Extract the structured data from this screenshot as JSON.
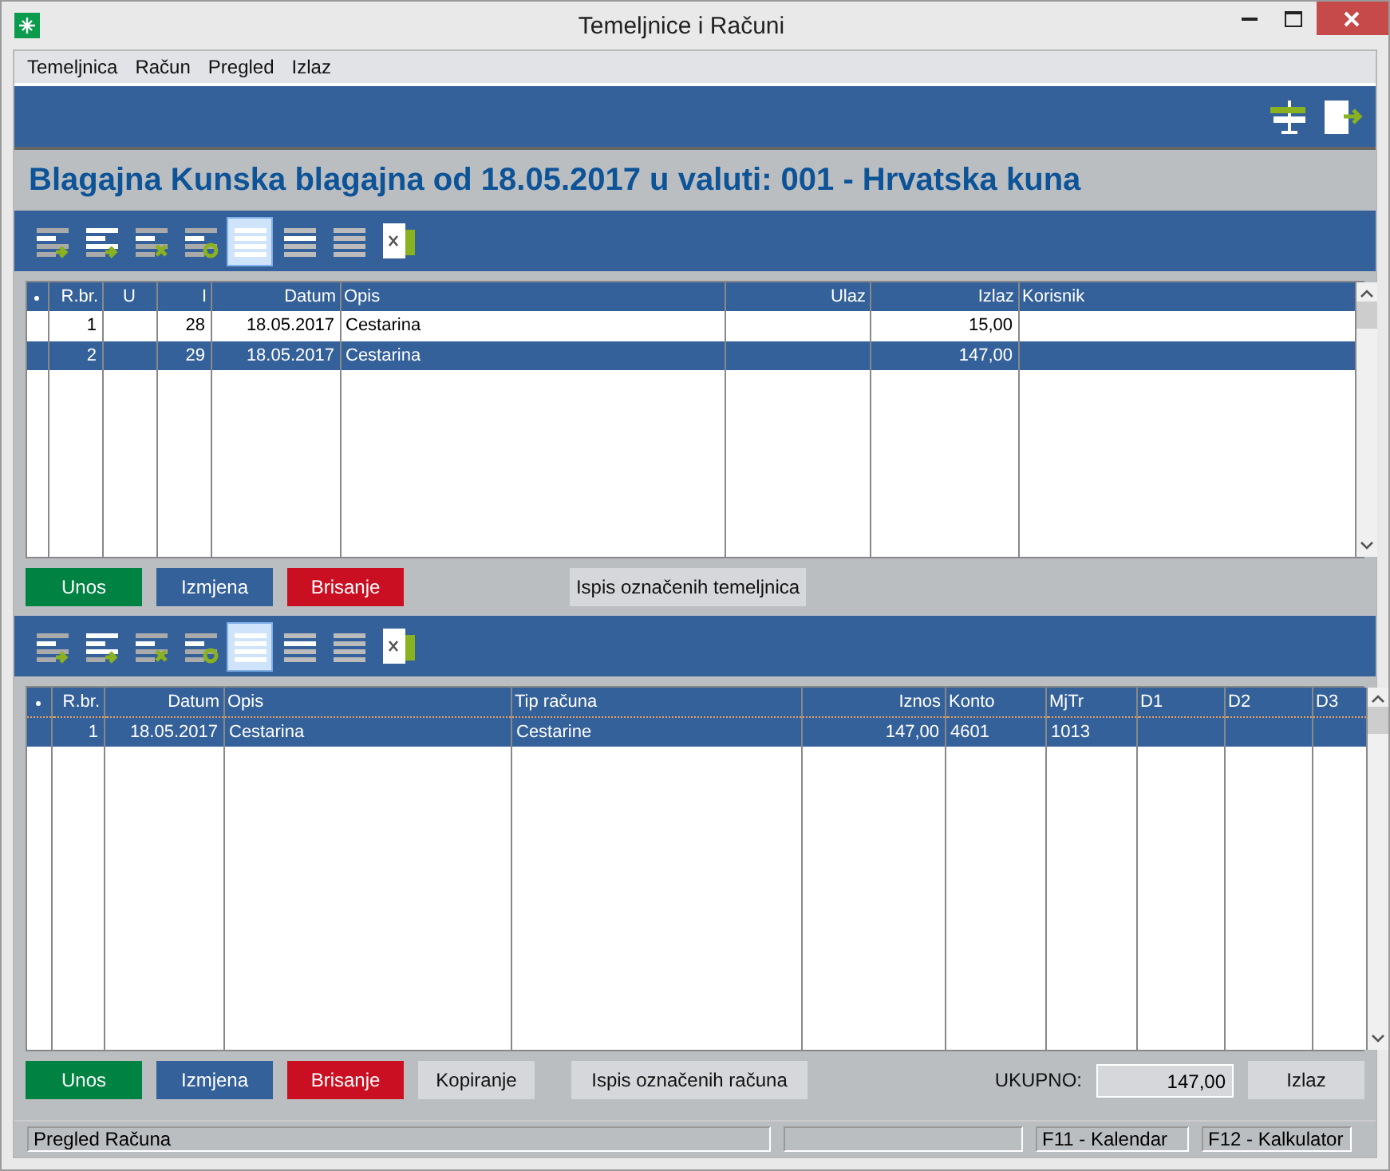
{
  "window": {
    "title": "Temeljnice i Računi"
  },
  "menu": [
    "Temeljnica",
    "Račun",
    "Pregled",
    "Izlaz"
  ],
  "heading": "Blagajna Kunska blagajna od 18.05.2017 u valuti: 001 - Hrvatska kuna",
  "toolbar_top": [
    {
      "kind": "add",
      "selected": false
    },
    {
      "kind": "insert",
      "selected": false
    },
    {
      "kind": "delete",
      "selected": false
    },
    {
      "kind": "refresh",
      "selected": false
    },
    {
      "kind": "lines",
      "selected": true
    },
    {
      "kind": "wide",
      "selected": false
    },
    {
      "kind": "compact",
      "selected": false
    },
    {
      "kind": "excel",
      "selected": false
    }
  ],
  "journal_table": {
    "columns": [
      "R.br.",
      "U",
      "I",
      "Datum",
      "Opis",
      "Ulaz",
      "Izlaz",
      "Korisnik"
    ],
    "rows": [
      {
        "selected": false,
        "cells": [
          "1",
          null,
          "28",
          "18.05.2017",
          "Cestarina",
          null,
          "15,00",
          null
        ]
      },
      {
        "selected": true,
        "cells": [
          "2",
          null,
          "29",
          "18.05.2017",
          "Cestarina",
          null,
          "147,00",
          null
        ]
      }
    ]
  },
  "journal_buttons": [
    {
      "kind": "add",
      "label": "Unos"
    },
    {
      "kind": "edit",
      "label": "Izmjena"
    },
    {
      "kind": "delete",
      "label": "Brisanje"
    },
    {
      "kind": "print",
      "label": "Ispis označenih temeljnica"
    }
  ],
  "toolbar_bottom": [
    {
      "kind": "add",
      "selected": false
    },
    {
      "kind": "insert",
      "selected": false
    },
    {
      "kind": "delete",
      "selected": false
    },
    {
      "kind": "refresh",
      "selected": false
    },
    {
      "kind": "lines",
      "selected": true
    },
    {
      "kind": "wide",
      "selected": false
    },
    {
      "kind": "compact",
      "selected": false
    },
    {
      "kind": "excel",
      "selected": false
    }
  ],
  "invoice_table": {
    "columns": [
      "R.br.",
      "Datum",
      "Opis",
      "Tip računa",
      "Iznos",
      "Konto",
      "MjTr",
      "D1",
      "D2",
      "D3"
    ],
    "rows": [
      {
        "selected": true,
        "cells": [
          "1",
          "18.05.2017",
          "Cestarina",
          "Cestarine",
          "147,00",
          "4601",
          "1013",
          null,
          null,
          null
        ]
      }
    ]
  },
  "invoice_buttons": [
    {
      "kind": "add",
      "label": "Unos"
    },
    {
      "kind": "edit",
      "label": "Izmjena"
    },
    {
      "kind": "delete",
      "label": "Brisanje"
    },
    {
      "kind": "plain",
      "label": "Kopiranje"
    },
    {
      "kind": "print",
      "label": "Ispis označenih računa"
    }
  ],
  "total": {
    "label": "UKUPNO:",
    "value": "147,00"
  },
  "exit_button": "Izlaz",
  "status_bar": {
    "message": "Pregled Računa",
    "shortcuts": [
      "F11 - Kalendar",
      "F12 - Kalkulator"
    ]
  }
}
